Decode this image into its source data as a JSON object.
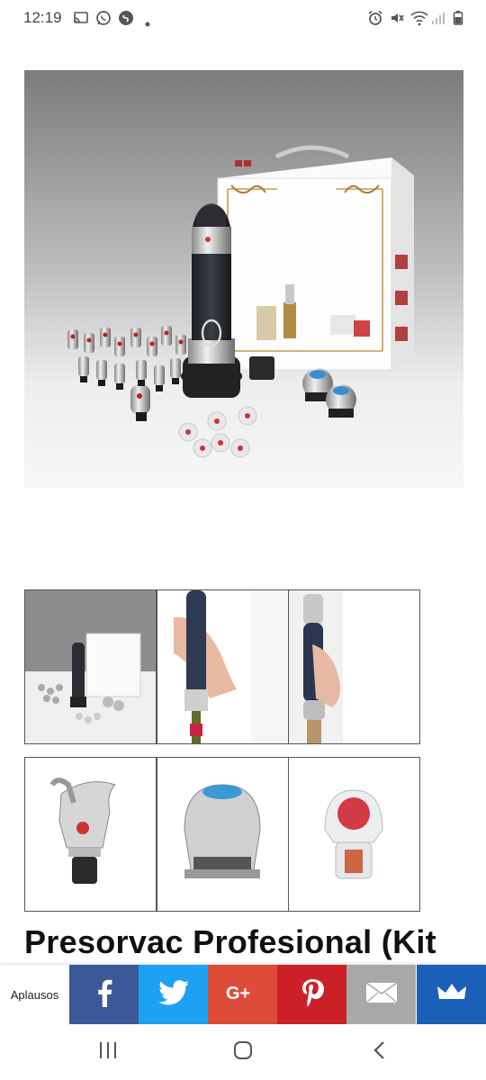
{
  "status_bar": {
    "time": "12:19",
    "left_icons": [
      "cast-icon",
      "whatsapp-icon",
      "shazam-icon",
      "dot-icon"
    ],
    "right_icons": [
      "alarm-icon",
      "mute-icon",
      "wifi-icon",
      "signal-icon",
      "battery-icon"
    ]
  },
  "gallery": {
    "main_image": "presorvac-kit-photo",
    "thumbnails": [
      "kit-overview-thumb",
      "pump-on-bottle-thumb",
      "pump-in-hand-thumb",
      "pourer-stopper-thumb",
      "pump-base-thumb",
      "red-stopper-thumb"
    ]
  },
  "product": {
    "title": "Presorvac Profesional (Kit"
  },
  "share_bar": {
    "label": "Aplausos",
    "buttons": [
      {
        "name": "facebook",
        "color": "#3b5998"
      },
      {
        "name": "twitter",
        "color": "#1da1f2"
      },
      {
        "name": "google-plus",
        "color": "#dd4b39"
      },
      {
        "name": "pinterest",
        "color": "#cb2027"
      },
      {
        "name": "email",
        "color": "#a8a8a8"
      },
      {
        "name": "sumo",
        "color": "#1a60b9"
      }
    ]
  },
  "nav_bar": {
    "buttons": [
      "recent-apps",
      "home",
      "back"
    ]
  }
}
